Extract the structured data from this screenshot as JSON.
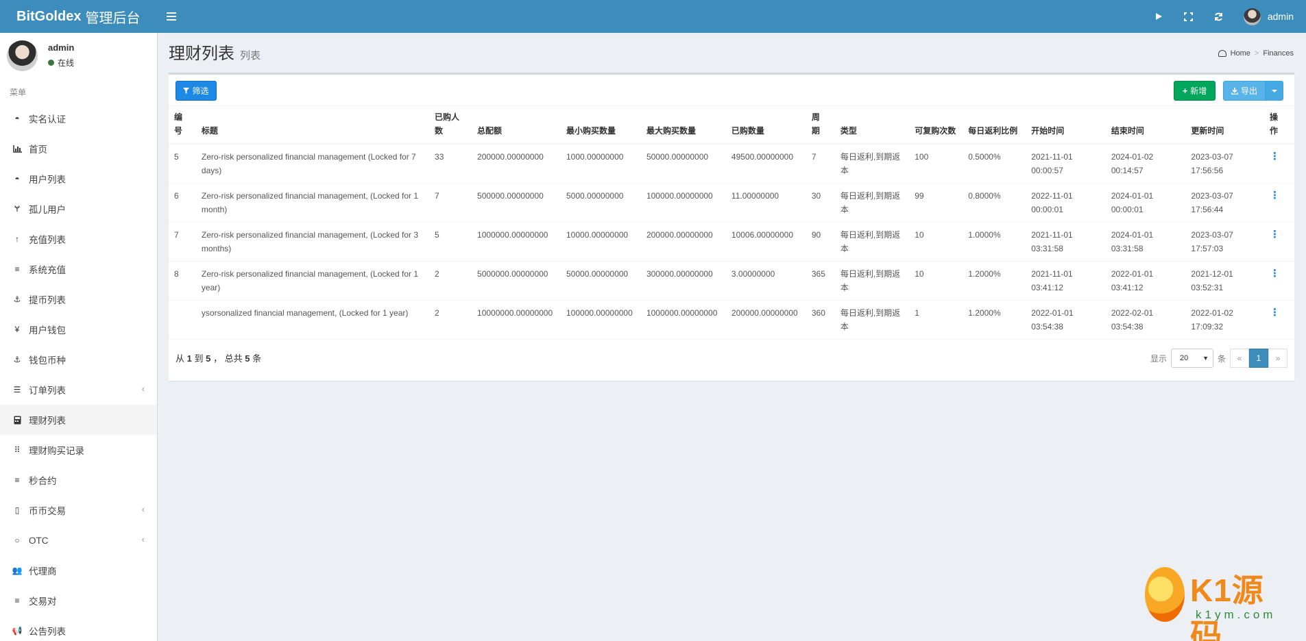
{
  "header": {
    "brand_bold": "BitGoldex",
    "brand_rest": "管理后台",
    "user": "admin"
  },
  "sidebar": {
    "user_name": "admin",
    "status": "在线",
    "menu_header": "菜单",
    "items": [
      {
        "label": "实名认证",
        "icon": "shield-icon"
      },
      {
        "label": "首页",
        "icon": "bar-chart-icon"
      },
      {
        "label": "用户列表",
        "icon": "shield-icon"
      },
      {
        "label": "孤儿用户",
        "icon": "child-icon"
      },
      {
        "label": "充值列表",
        "icon": "arrow-up-icon"
      },
      {
        "label": "系统充值",
        "icon": "list-icon"
      },
      {
        "label": "提币列表",
        "icon": "anchor-icon"
      },
      {
        "label": "用户钱包",
        "icon": "yen-icon"
      },
      {
        "label": "钱包币种",
        "icon": "anchor-icon"
      },
      {
        "label": "订单列表",
        "icon": "stack-icon"
      },
      {
        "label": "理财列表",
        "icon": "calculator-icon"
      },
      {
        "label": "理财购买记录",
        "icon": "grid-icon"
      },
      {
        "label": "秒合约",
        "icon": "list-icon"
      },
      {
        "label": "币币交易",
        "icon": "building-icon"
      },
      {
        "label": "OTC",
        "icon": "circle-icon"
      },
      {
        "label": "代理商",
        "icon": "users-icon"
      },
      {
        "label": "交易对",
        "icon": "list-icon"
      },
      {
        "label": "公告列表",
        "icon": "bullhorn-icon"
      }
    ]
  },
  "page": {
    "title": "理财列表",
    "subtitle": "列表",
    "breadcrumb_home": "Home",
    "breadcrumb_current": "Finances"
  },
  "toolbar": {
    "filter": "筛选",
    "add": "新增",
    "export": "导出"
  },
  "table": {
    "headers": [
      "编号",
      "标题",
      "已购人数",
      "总配额",
      "最小购买数量",
      "最大购买数量",
      "已购数量",
      "周期",
      "类型",
      "可复购次数",
      "每日返利比例",
      "开始时间",
      "结束时间",
      "更新时间",
      "操作"
    ],
    "rows": [
      [
        "5",
        "Zero-risk personalized financial management (Locked for 7 days)",
        "33",
        "200000.00000000",
        "1000.00000000",
        "50000.00000000",
        "49500.00000000",
        "7",
        "每日返利,到期返本",
        "100",
        "0.5000%",
        "2021-11-01 00:00:57",
        "2024-01-02 00:14:57",
        "2023-03-07 17:56:56"
      ],
      [
        "6",
        "Zero-risk personalized financial management, (Locked for 1 month)",
        "7",
        "500000.00000000",
        "5000.00000000",
        "100000.00000000",
        "11.00000000",
        "30",
        "每日返利,到期返本",
        "99",
        "0.8000%",
        "2022-11-01 00:00:01",
        "2024-01-01 00:00:01",
        "2023-03-07 17:56:44"
      ],
      [
        "7",
        "Zero-risk personalized financial management, (Locked for 3 months)",
        "5",
        "1000000.00000000",
        "10000.00000000",
        "200000.00000000",
        "10006.00000000",
        "90",
        "每日返利,到期返本",
        "10",
        "1.0000%",
        "2021-11-01 03:31:58",
        "2024-01-01 03:31:58",
        "2023-03-07 17:57:03"
      ],
      [
        "8",
        "Zero-risk personalized financial management, (Locked for 1 year)",
        "2",
        "5000000.00000000",
        "50000.00000000",
        "300000.00000000",
        "3.00000000",
        "365",
        "每日返利,到期返本",
        "10",
        "1.2000%",
        "2021-11-01 03:41:12",
        "2022-01-01 03:41:12",
        "2021-12-01 03:52:31"
      ],
      [
        "",
        "ysorsonalized financial management, (Locked for 1 year)",
        "2",
        "10000000.00000000",
        "100000.00000000",
        "1000000.00000000",
        "200000.00000000",
        "360",
        "每日返利,到期返本",
        "1",
        "1.2000%",
        "2022-01-01 03:54:38",
        "2022-02-01 03:54:38",
        "2022-01-02 17:09:32"
      ]
    ]
  },
  "footer": {
    "from_label": "从",
    "from": "1",
    "to_label": "到",
    "to": "5",
    "total_label": "，  总共",
    "total": "5",
    "unit": "条",
    "show_label": "显示",
    "page_size": "20",
    "page_unit": "条",
    "prev": "«",
    "current_page": "1",
    "next": "»"
  },
  "watermark": {
    "text": "K1源码",
    "sub": "k1ym.com"
  }
}
